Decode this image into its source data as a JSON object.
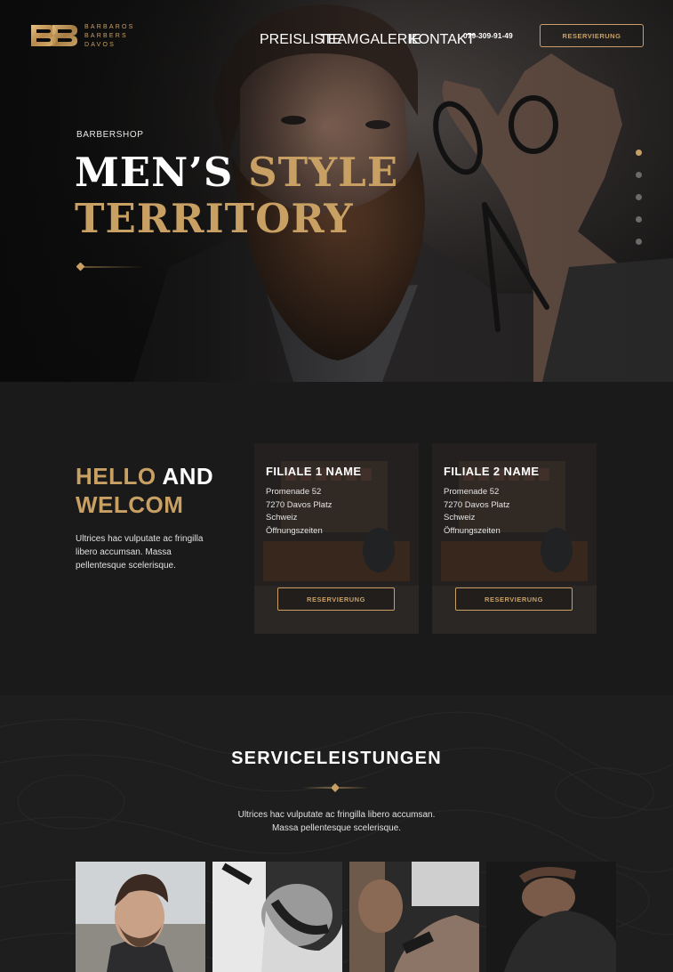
{
  "header": {
    "logo": {
      "line1": "BARBAROS",
      "line2": "BARBERS",
      "line3": "DAVOS"
    },
    "nav": [
      "PREISLISTE",
      "TEAM",
      "GALERIE",
      "KONTAKT"
    ],
    "phone": "079-309-91-49",
    "cta_label": "RESERVIERUNG"
  },
  "hero": {
    "eyebrow": "BARBERSHOP",
    "title_part1": "MEN’S ",
    "title_part2": "STYLE",
    "title_part3": "TERRITORY",
    "slides_total": 5,
    "active_slide": 1
  },
  "welcome": {
    "title_gold1": "HELLO",
    "title_white": " AND",
    "title_gold2": "WELCOM",
    "text": "Ultrices hac vulputate ac fringilla libero accumsan. Massa pellentesque scelerisque.",
    "branches": [
      {
        "name": "FILIALE 1 NAME",
        "street": "Promenade 52",
        "city": "7270 Davos Platz",
        "country": "Schweiz",
        "hours": "Öffnungszeiten",
        "button": "RESERVIERUNG"
      },
      {
        "name": "FILIALE 2 NAME",
        "street": "Promenade 52",
        "city": "7270 Davos Platz",
        "country": "Schweiz",
        "hours": "Öffnungszeiten",
        "button": "RESERVIERUNG"
      }
    ]
  },
  "services": {
    "title": "SERVICELEISTUNGEN",
    "text_line1": "Ultrices hac vulputate ac fringilla libero accumsan.",
    "text_line2": "Massa pellentesque scelerisque."
  },
  "colors": {
    "gold": "#c9a063",
    "dark": "#1a1a1a",
    "text": "#e0e0e0"
  }
}
